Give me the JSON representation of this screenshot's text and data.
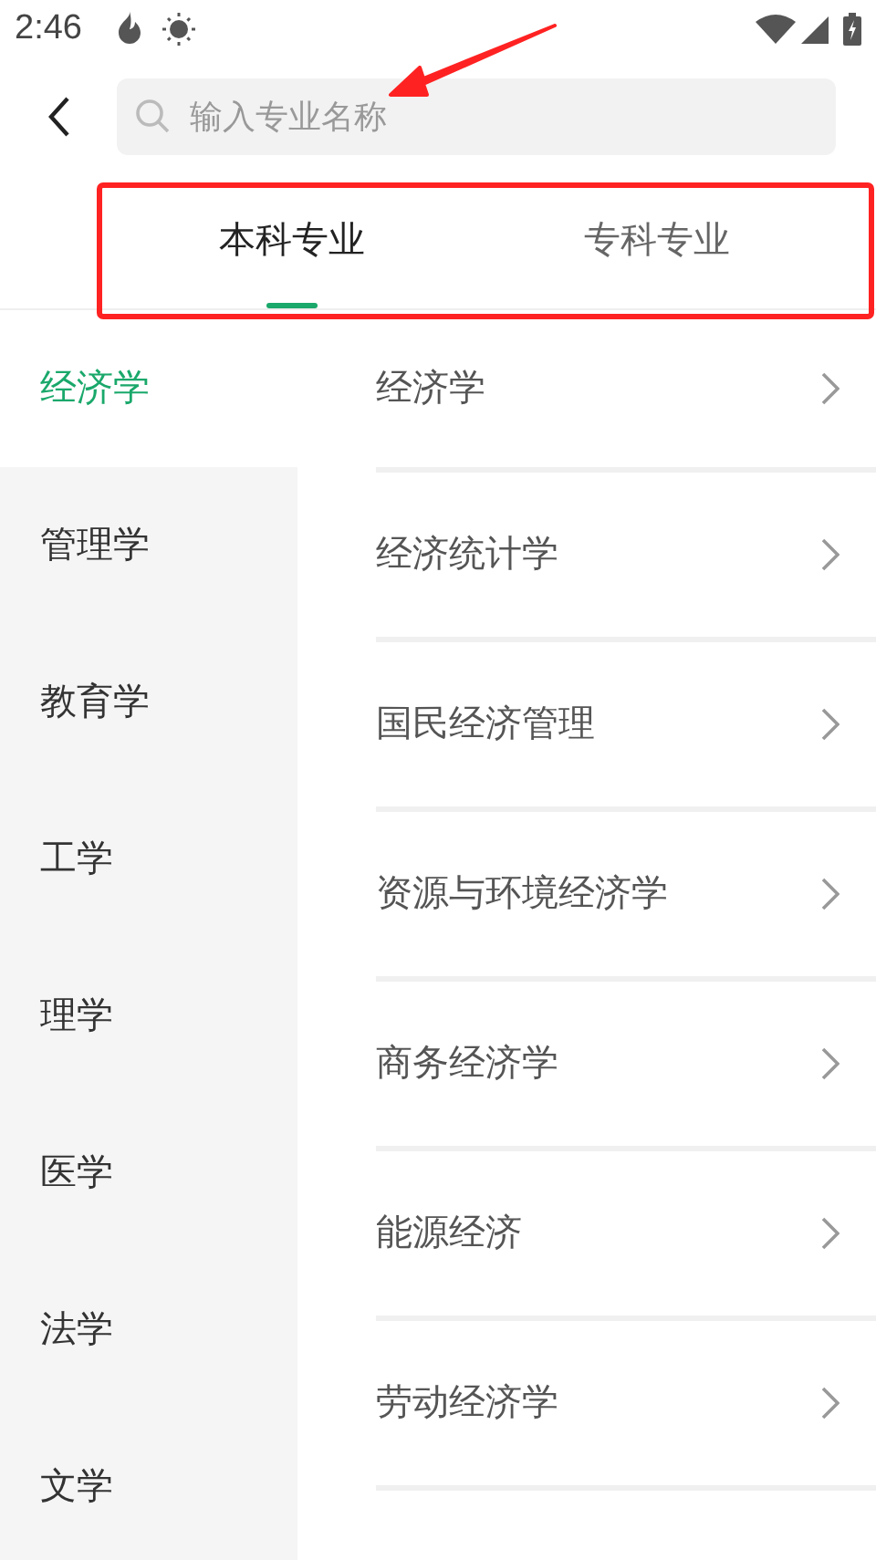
{
  "status_bar": {
    "time": "2:46"
  },
  "search": {
    "placeholder": "输入专业名称"
  },
  "tabs": [
    {
      "label": "本科专业",
      "selected": true
    },
    {
      "label": "专科专业",
      "selected": false
    }
  ],
  "categories": [
    {
      "label": "经济学",
      "selected": true
    },
    {
      "label": "管理学",
      "selected": false
    },
    {
      "label": "教育学",
      "selected": false
    },
    {
      "label": "工学",
      "selected": false
    },
    {
      "label": "理学",
      "selected": false
    },
    {
      "label": "医学",
      "selected": false
    },
    {
      "label": "法学",
      "selected": false
    },
    {
      "label": "文学",
      "selected": false
    }
  ],
  "majors": [
    {
      "label": "经济学"
    },
    {
      "label": "经济统计学"
    },
    {
      "label": "国民经济管理"
    },
    {
      "label": "资源与环境经济学"
    },
    {
      "label": "商务经济学"
    },
    {
      "label": "能源经济"
    },
    {
      "label": "劳动经济学"
    }
  ]
}
